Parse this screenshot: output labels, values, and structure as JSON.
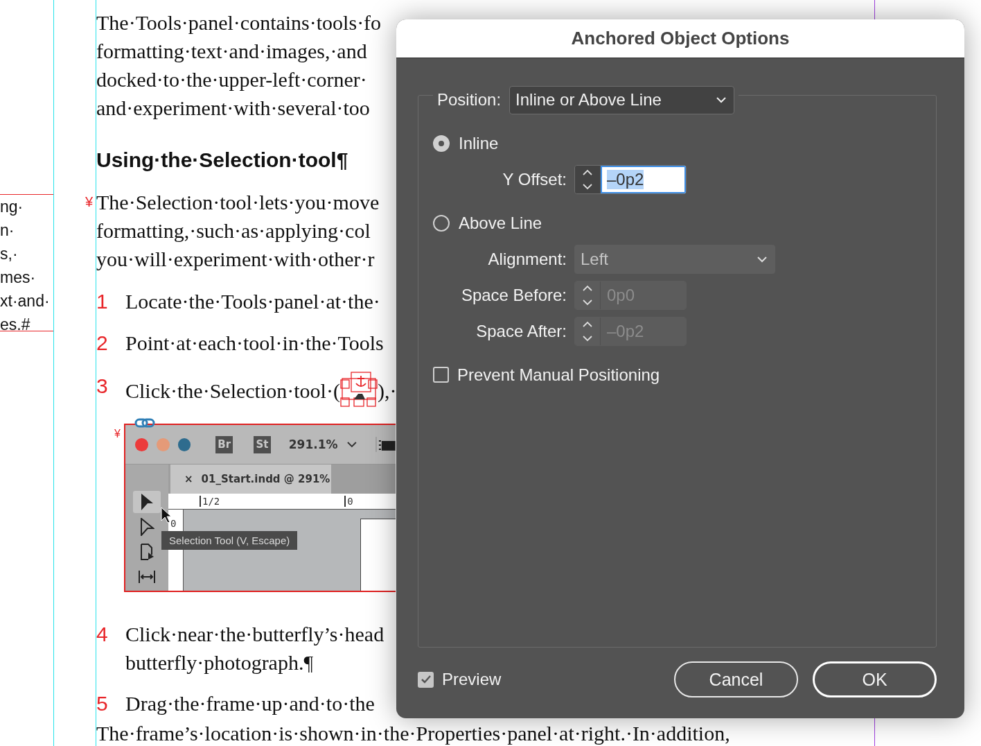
{
  "document": {
    "side_column": {
      "lines": [
        "ng·",
        "n·",
        "s,·",
        "mes·",
        "xt·and·",
        "es.#"
      ]
    },
    "intro_paragraph": {
      "lines": [
        "The·Tools·panel·contains·tools·fo",
        "formatting·text·and·images,·and",
        "docked·to·the·upper-left·corner·",
        "and·experiment·with·several·too"
      ]
    },
    "heading": "Using·the·Selection·tool¶",
    "paragraph": {
      "marker": "¥",
      "lines": [
        "The·Selection·tool·lets·you·move",
        "formatting,·such·as·applying·col",
        "you·will·experiment·with·other·r"
      ]
    },
    "steps": [
      {
        "number": "1",
        "lines": [
          "Locate·the·Tools·panel·at·the·"
        ]
      },
      {
        "number": "2",
        "lines": [
          "Point·at·each·tool·in·the·Tools"
        ]
      },
      {
        "number": "3",
        "lines": [
          "Click·the·Selection·tool·("
        ],
        "after_icon": "),·",
        "has_anchor": true
      },
      {
        "number": "4",
        "lines": [
          "Click·near·the·butterfly’s·head",
          "butterfly·photograph.¶"
        ]
      },
      {
        "number": "5",
        "lines": [
          "Drag·the·frame·up·and·to·the"
        ]
      }
    ],
    "figure": {
      "marker": "¥",
      "window_buttons": [
        {
          "color": "#ec3b3b"
        },
        {
          "color": "#e59a78"
        },
        {
          "color": "#2e6c8e"
        }
      ],
      "app_badges": [
        "Br",
        "St"
      ],
      "zoom": "291.1%",
      "tab": {
        "close": "×",
        "title": "01_Start.indd @ 291%"
      },
      "ruler_labels": [
        "1/2",
        "0"
      ],
      "vertical_ruler_label": "0",
      "tooltip": "Selection Tool (V, Escape)"
    },
    "trailing_line": "The·frame’s·location·is·shown·in·the·Properties·panel·at·right.·In·addition,"
  },
  "dialog": {
    "title": "Anchored Object Options",
    "position": {
      "label": "Position:",
      "value": "Inline or Above Line"
    },
    "modes": [
      {
        "label": "Inline",
        "selected": true,
        "fields": [
          {
            "kind": "stepper",
            "label": "Y Offset:",
            "value": "–0p2",
            "disabled": false,
            "text_selected": true
          }
        ]
      },
      {
        "label": "Above Line",
        "selected": false,
        "fields": [
          {
            "kind": "select",
            "label": "Alignment:",
            "value": "Left",
            "disabled": true
          },
          {
            "kind": "stepper",
            "label": "Space Before:",
            "value": "0p0",
            "disabled": true,
            "text_selected": false
          },
          {
            "kind": "stepper",
            "label": "Space After:",
            "value": "–0p2",
            "disabled": true,
            "text_selected": false
          }
        ]
      }
    ],
    "prevent_manual_positioning": {
      "label": "Prevent Manual Positioning",
      "checked": false
    },
    "preview": {
      "label": "Preview",
      "checked": true
    },
    "buttons": [
      {
        "label": "Cancel",
        "default": false
      },
      {
        "label": "OK",
        "default": true
      }
    ]
  }
}
